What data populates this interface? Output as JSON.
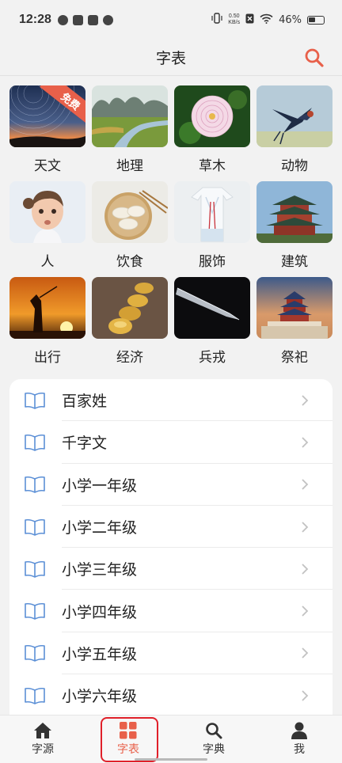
{
  "status_bar": {
    "time": "12:28",
    "net_speed_value": "0.50",
    "net_speed_unit": "KB/s",
    "battery": "46%",
    "app_icons": [
      "app-icon",
      "mail-icon",
      "tiktok-icon",
      "app-icon"
    ]
  },
  "header": {
    "title": "字表",
    "search_icon": "search-icon"
  },
  "categories": [
    {
      "label": "天文",
      "badge": "免费",
      "image": "star-trails-photo"
    },
    {
      "label": "地理",
      "image": "river-landscape-photo"
    },
    {
      "label": "草木",
      "image": "dahlia-flower-photo"
    },
    {
      "label": "动物",
      "image": "swallow-bird-photo"
    },
    {
      "label": "人",
      "image": "child-portrait-photo"
    },
    {
      "label": "饮食",
      "image": "dumplings-photo"
    },
    {
      "label": "服饰",
      "image": "hanfu-robe-photo"
    },
    {
      "label": "建筑",
      "image": "pagoda-tower-photo"
    },
    {
      "label": "出行",
      "image": "silhouette-sunset-photo"
    },
    {
      "label": "经济",
      "image": "gold-ingots-photo"
    },
    {
      "label": "兵戎",
      "image": "sword-blade-photo"
    },
    {
      "label": "祭祀",
      "image": "temple-of-heaven-photo"
    }
  ],
  "lists": [
    {
      "label": "百家姓"
    },
    {
      "label": "千字文"
    },
    {
      "label": "小学一年级"
    },
    {
      "label": "小学二年级"
    },
    {
      "label": "小学三年级"
    },
    {
      "label": "小学四年级"
    },
    {
      "label": "小学五年级"
    },
    {
      "label": "小学六年级"
    }
  ],
  "tabbar": {
    "tabs": [
      {
        "label": "字源",
        "icon": "home-icon"
      },
      {
        "label": "字表",
        "icon": "grid-icon",
        "active": true
      },
      {
        "label": "字典",
        "icon": "search-icon"
      },
      {
        "label": "我",
        "icon": "person-icon"
      }
    ]
  },
  "colors": {
    "accent": "#e8604a",
    "book_icon": "#5b8fd6",
    "highlight_ring": "#e0202a"
  }
}
